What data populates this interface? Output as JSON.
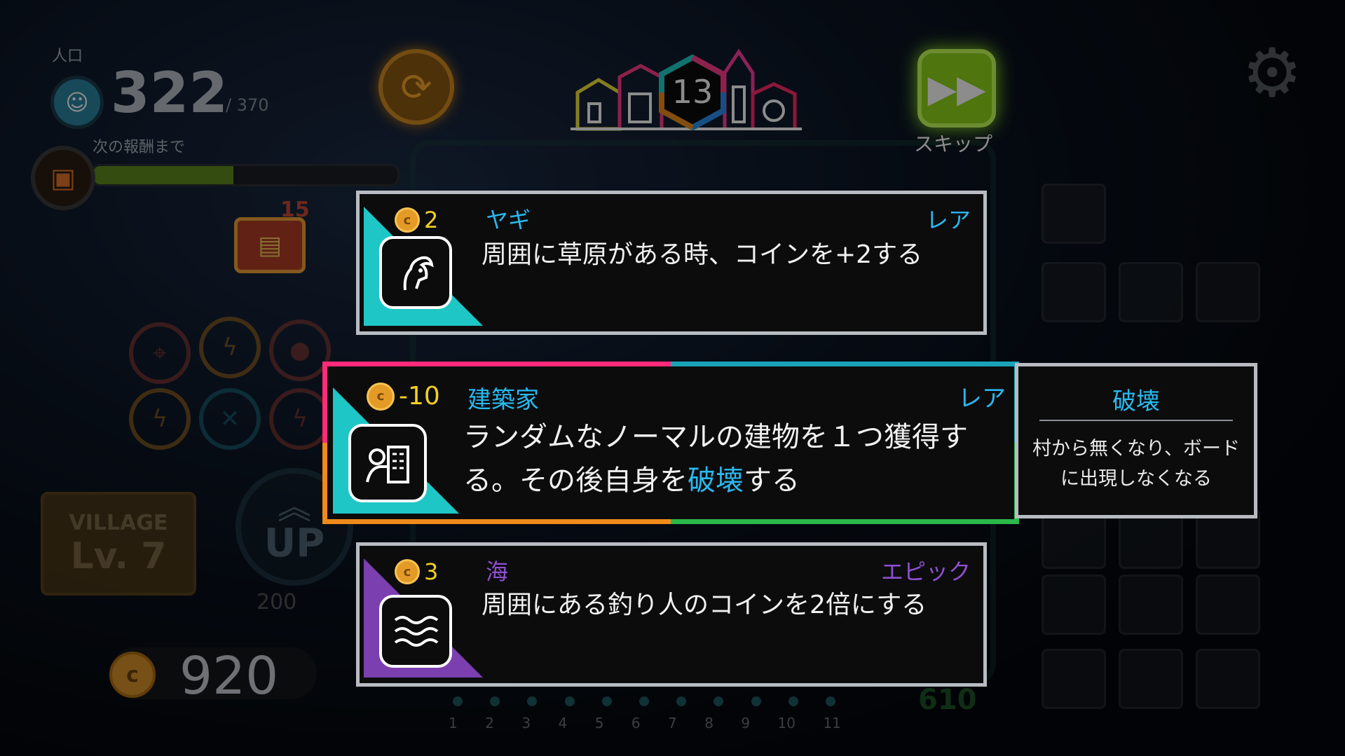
{
  "hud": {
    "population_label": "人口",
    "population_value": "322",
    "population_max": "/ 370",
    "reward_label": "次の報酬まで",
    "reward_progress": 0.46,
    "chest_count": "15",
    "village_title": "VILLAGE",
    "village_level": "Lv. 7",
    "up_label": "UP",
    "up_cost": "200",
    "coins": "920",
    "side_score": "610"
  },
  "round": {
    "number": "13"
  },
  "skip": {
    "label": "スキップ"
  },
  "board_numbers": [
    "1",
    "2",
    "3",
    "4",
    "5",
    "6",
    "7",
    "8",
    "9",
    "10",
    "11"
  ],
  "cards": [
    {
      "cost": "2",
      "name": "ヤギ",
      "rarity": "レア",
      "description": "周囲に草原がある時、コインを+2する",
      "icon": "goat-icon",
      "accent": "#1fc6c6"
    },
    {
      "cost": "-10",
      "name": "建築家",
      "rarity": "レア",
      "description_part1": "ランダムなノーマルの建物を１つ獲得する。その後自身を",
      "keyword": "破壊",
      "description_part2": "する",
      "icon": "architect-icon",
      "accent": "#1fc6c6",
      "selected": true
    },
    {
      "cost": "3",
      "name": "海",
      "rarity": "エピック",
      "description": "周囲にある釣り人のコインを2倍にする",
      "icon": "waves-icon",
      "accent": "#7b3fb0"
    }
  ],
  "tooltip": {
    "title": "破壊",
    "body": "村から無くなり、ボードに出現しなくなる"
  },
  "colors": {
    "rare": "#29b9ef",
    "epic": "#8e4fd0",
    "coin": "#f3d024",
    "skip": "#8fd61a"
  }
}
